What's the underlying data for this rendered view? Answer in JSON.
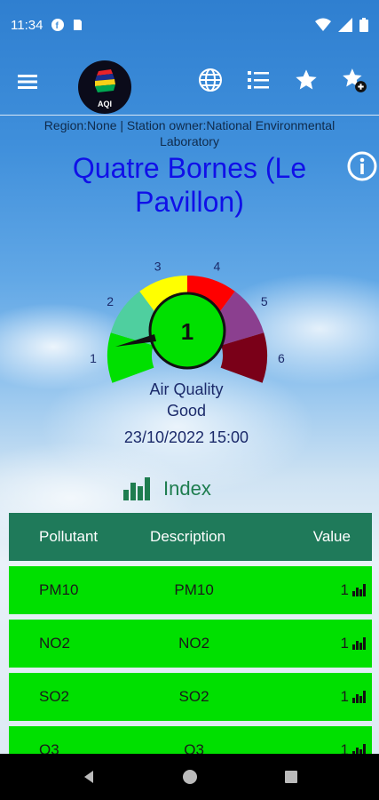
{
  "status_bar": {
    "time": "11:34",
    "icons": [
      "f-badge-icon",
      "sd-card-icon",
      "wifi-icon",
      "signal-icon",
      "battery-icon"
    ]
  },
  "app_bar": {
    "logo_text": "AQI",
    "actions": [
      "globe-icon",
      "list-icon",
      "star-icon",
      "star-add-icon"
    ]
  },
  "meta_text": "Region:None | Station owner:National Environmental Laboratory",
  "station_name": "Quatre Bornes (Le Pavillon)",
  "gauge": {
    "value": "1",
    "labels": [
      "1",
      "2",
      "3",
      "4",
      "5",
      "6"
    ],
    "colors": [
      "#00e000",
      "#4fcf9f",
      "#ffff00",
      "#ff0000",
      "#8b3f8f",
      "#7a0018"
    ]
  },
  "air_quality": {
    "label": "Air Quality",
    "status": "Good"
  },
  "datetime": "23/10/2022 15:00",
  "index_title": "Index",
  "table": {
    "headers": [
      "Pollutant",
      "Description",
      "Value"
    ],
    "rows": [
      {
        "pollutant": "PM10",
        "description": "PM10",
        "value": "1"
      },
      {
        "pollutant": "NO2",
        "description": "NO2",
        "value": "1"
      },
      {
        "pollutant": "SO2",
        "description": "SO2",
        "value": "1"
      },
      {
        "pollutant": "O3",
        "description": "O3",
        "value": "1"
      }
    ]
  },
  "colors": {
    "station_title": "#1010e8",
    "table_header": "#1f7a5a",
    "row_good": "#00e000"
  }
}
